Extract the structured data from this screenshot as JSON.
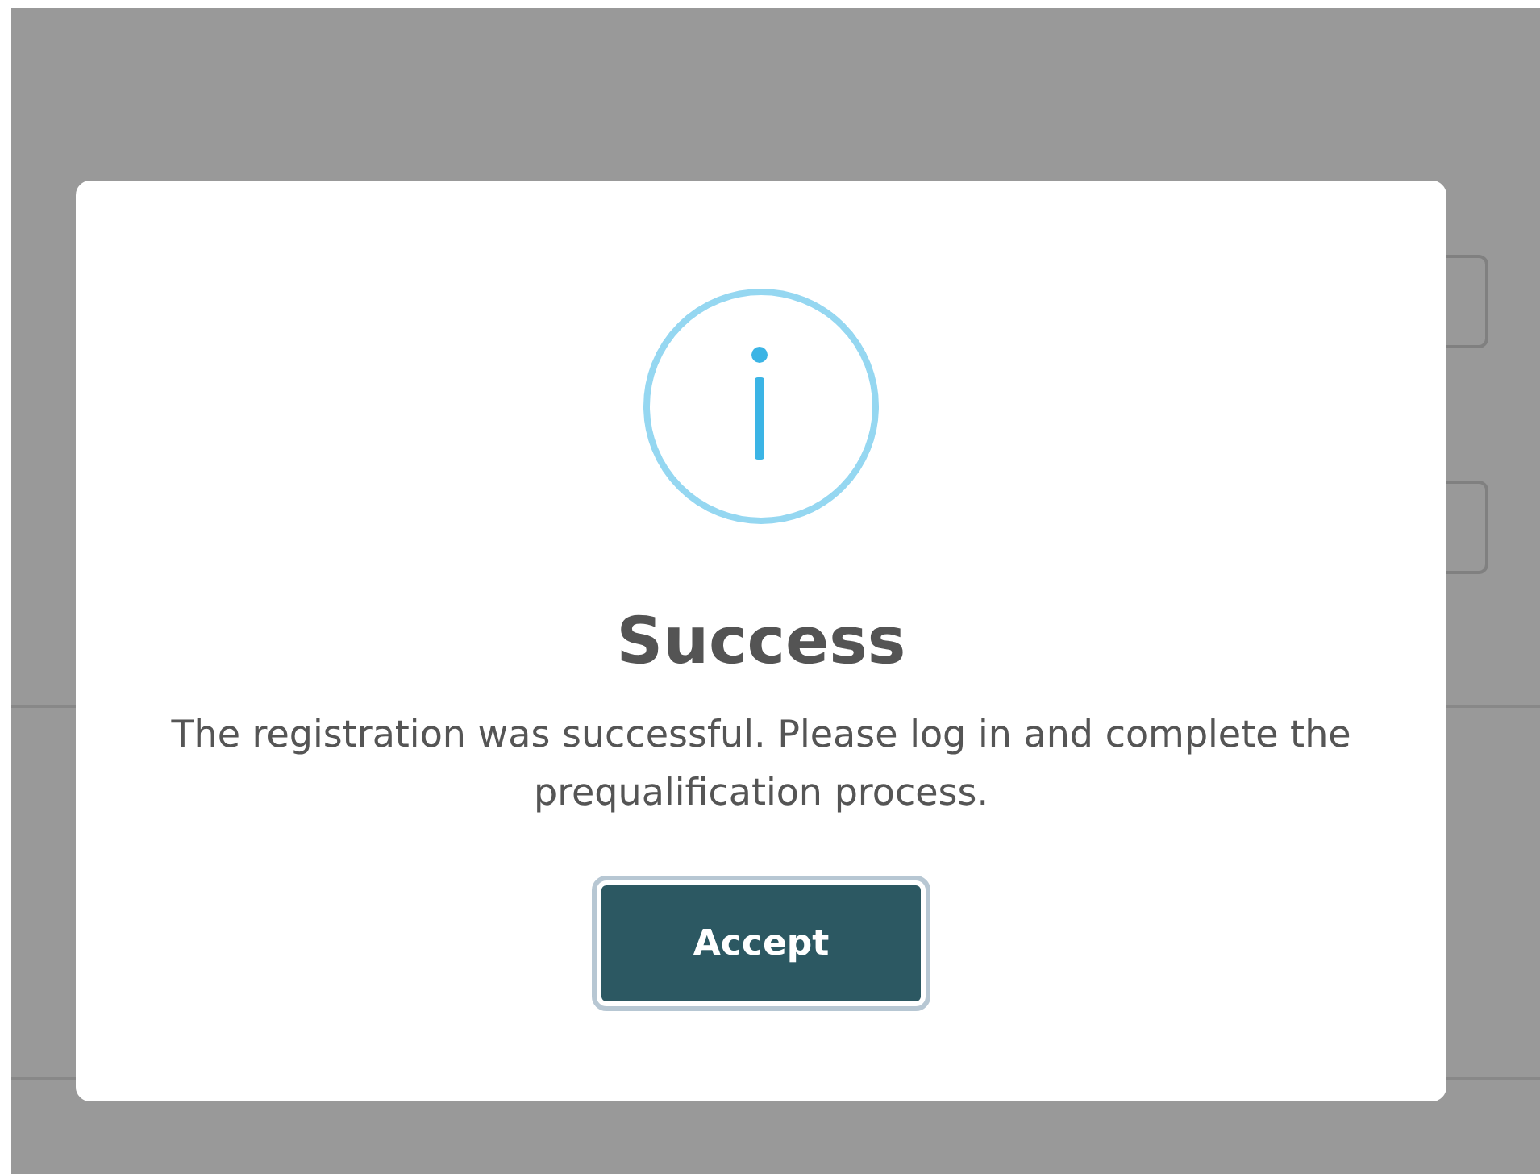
{
  "dialog": {
    "title": "Success",
    "message": "The registration was successful. Please log in and complete the prequalification process.",
    "buttons": [
      "Accept"
    ]
  }
}
